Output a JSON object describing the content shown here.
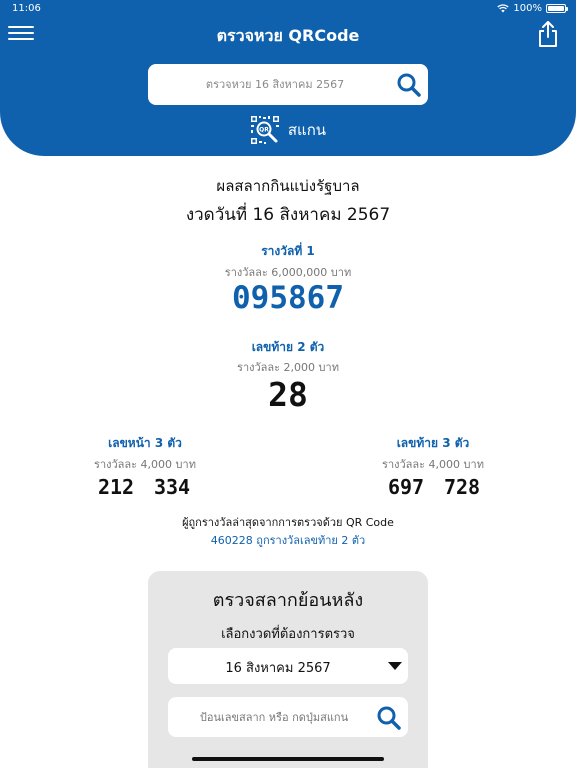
{
  "status": {
    "time": "11:06",
    "battery": "100%"
  },
  "header": {
    "title": "ตรวจหวย QRCode",
    "menu_icon": "hamburger-icon",
    "share_icon": "share-icon"
  },
  "search": {
    "placeholder": "ตรวจหวย 16 สิงหาคม 2567"
  },
  "scan": {
    "label": "สแกน",
    "icon": "qr-scan-icon"
  },
  "result": {
    "title": "ผลสลากกินแบ่งรัฐบาล",
    "date": "งวดวันที่ 16 สิงหาคม 2567",
    "first": {
      "label": "รางวัลที่ 1",
      "amount": "รางวัลละ 6,000,000 บาท",
      "number": "095867"
    },
    "last2": {
      "label": "เลขท้าย 2 ตัว",
      "amount": "รางวัลละ 2,000 บาท",
      "number": "28"
    },
    "front3": {
      "label": "เลขหน้า 3 ตัว",
      "amount": "รางวัลละ 4,000 บาท",
      "numbers": [
        "212",
        "334"
      ]
    },
    "last3": {
      "label": "เลขท้าย 3 ตัว",
      "amount": "รางวัลละ 4,000 บาท",
      "numbers": [
        "697",
        "728"
      ]
    }
  },
  "qr_winner": {
    "line1": "ผู้ถูกรางวัลล่าสุดจากการตรวจด้วย QR Code",
    "line2": "460228 ถูกรางวัลเลขท้าย 2 ตัว"
  },
  "history": {
    "title": "ตรวจสลากย้อนหลัง",
    "subtitle": "เลือกงวดที่ต้องการตรวจ",
    "selected_draw": "16 สิงหาคม 2567",
    "input_placeholder": "ป้อนเลขสลาก หรือ กดปุ่มสแกน"
  },
  "colors": {
    "brand": "#1061ad",
    "card": "#e6e6e6"
  }
}
